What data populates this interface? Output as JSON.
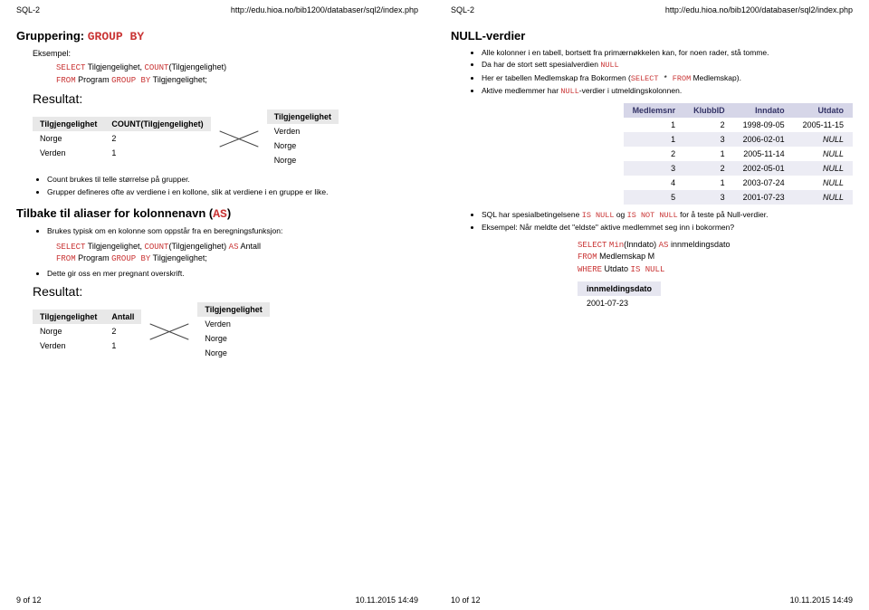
{
  "left": {
    "hdr_l": "SQL-2",
    "hdr_r": "http://edu.hioa.no/bib1200/databaser/sql2/index.php",
    "ftr_l": "9 of 12",
    "ftr_r": "10.11.2015 14:49",
    "h_group_pre": "Gruppering: ",
    "h_group_kw": "GROUP BY",
    "eksempel": "Eksempel:",
    "q1_l1_a": "SELECT",
    "q1_l1_b": " Tilgjengelighet, ",
    "q1_l1_c": "COUNT",
    "q1_l1_d": "(Tilgjengelighet)",
    "q1_l2_a": "FROM",
    "q1_l2_b": " Program ",
    "q1_l2_c": "GROUP BY",
    "q1_l2_d": " Tilgjengelighet;",
    "resultat": "Resultat:",
    "tbl1_h1": "Tilgjengelighet",
    "tbl1_h2": "COUNT(Tilgjengelighet)",
    "tbl1_r1c1": "Norge",
    "tbl1_r1c2": "2",
    "tbl1_r2c1": "Verden",
    "tbl1_r2c2": "1",
    "mini_h": "Tilgjengelighet",
    "mini_r1": "Verden",
    "mini_r2": "Norge",
    "mini_r3": "Norge",
    "bul1": "Count brukes til telle størrelse på grupper.",
    "bul2": "Grupper defineres ofte av verdiene i en kollone, slik at verdiene i en gruppe er like.",
    "h_alias_pre": "Tilbake til aliaser for kolonnenavn (",
    "h_alias_kw": "AS",
    "h_alias_post": ")",
    "bul3": "Brukes typisk om en kolonne som oppstår fra en beregningsfunksjon:",
    "q2_l1_a": "SELECT",
    "q2_l1_b": " Tilgjengelighet, ",
    "q2_l1_c": "COUNT",
    "q2_l1_d": "(Tilgjengelighet) ",
    "q2_l1_e": "AS",
    "q2_l1_f": " Antall",
    "q2_l2_a": "FROM",
    "q2_l2_b": " Program ",
    "q2_l2_c": "GROUP BY",
    "q2_l2_d": " Tilgjengelighet;",
    "bul4": "Dette gir oss en mer pregnant overskrift.",
    "tbl2_h1": "Tilgjengelighet",
    "tbl2_h2": "Antall",
    "tbl2_r1c1": "Norge",
    "tbl2_r1c2": "2",
    "tbl2_r2c1": "Verden",
    "tbl2_r2c2": "1"
  },
  "right": {
    "hdr_l": "SQL-2",
    "hdr_r": "http://edu.hioa.no/bib1200/databaser/sql2/index.php",
    "ftr_l": "10 of 12",
    "ftr_r": "10.11.2015 14:49",
    "h_null": "NULL-verdier",
    "bul1": "Alle kolonner i en tabell, bortsett fra primærnøkkelen kan, for noen rader, stå tomme.",
    "bul2_a": "Da har de stort sett spesialverdien ",
    "bul2_b": "NULL",
    "bul3_a": "Her er tabellen Medlemskap fra Bokormen (",
    "bul3_b": "SELECT",
    "bul3_c": " * ",
    "bul3_d": "FROM",
    "bul3_e": " Medlemskap",
    "bul3_f": ").",
    "bul4_a": "Aktive medlemmer har ",
    "bul4_b": "NULL",
    "bul4_c": "-verdier i utmeldingskolonnen.",
    "mh1": "Medlemsnr",
    "mh2": "KlubbID",
    "mh3": "Inndato",
    "mh4": "Utdato",
    "m": [
      [
        "1",
        "2",
        "1998-09-05",
        "2005-11-15"
      ],
      [
        "1",
        "3",
        "2006-02-01",
        "NULL"
      ],
      [
        "2",
        "1",
        "2005-11-14",
        "NULL"
      ],
      [
        "3",
        "2",
        "2002-05-01",
        "NULL"
      ],
      [
        "4",
        "1",
        "2003-07-24",
        "NULL"
      ],
      [
        "5",
        "3",
        "2001-07-23",
        "NULL"
      ]
    ],
    "bul5_a": "SQL har spesialbetingelsene ",
    "bul5_b": "IS NULL",
    "bul5_c": " og ",
    "bul5_d": "IS NOT NULL",
    "bul5_e": " for å teste på Null-verdier.",
    "bul6": "Eksempel: Når meldte det \"eldste\" aktive medlemmet seg inn i bokormen?",
    "q3_l1_a": "SELECT",
    "q3_l1_b": " ",
    "q3_l1_c": "Min",
    "q3_l1_d": "(Inndato) ",
    "q3_l1_e": "AS",
    "q3_l1_f": " innmeldingsdato",
    "q3_l2_a": "FROM",
    "q3_l2_b": " Medlemskap M",
    "q3_l3_a": "WHERE",
    "q3_l3_b": " Utdato ",
    "q3_l3_c": "IS NULL",
    "res_h": "innmeldingsdato",
    "res_v": "2001-07-23"
  }
}
